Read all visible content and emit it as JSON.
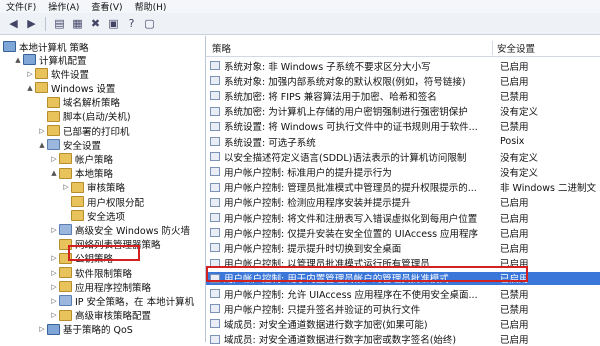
{
  "menu": [
    "文件(F)",
    "操作(A)",
    "查看(V)",
    "帮助(H)"
  ],
  "toolbar_icons": [
    "back-arrow-icon",
    "forward-arrow-icon",
    "up-folder-icon",
    "show-tree-icon",
    "delete-icon",
    "properties-icon",
    "help-icon",
    "console-icon"
  ],
  "tree": {
    "root": "本地计算机 策略",
    "items": [
      {
        "label": "计算机配置",
        "depth": 1,
        "icon": "pc",
        "exp": "▲"
      },
      {
        "label": "软件设置",
        "depth": 2,
        "icon": "fold",
        "exp": "▷"
      },
      {
        "label": "Windows 设置",
        "depth": 2,
        "icon": "fold",
        "exp": "▲"
      },
      {
        "label": "域名解析策略",
        "depth": 3,
        "icon": "fold",
        "exp": ""
      },
      {
        "label": "脚本(启动/关机)",
        "depth": 3,
        "icon": "fold",
        "exp": ""
      },
      {
        "label": "已部署的打印机",
        "depth": 3,
        "icon": "fold",
        "exp": "▷"
      },
      {
        "label": "安全设置",
        "depth": 3,
        "icon": "sec",
        "exp": "▲"
      },
      {
        "label": "帐户策略",
        "depth": 4,
        "icon": "fold",
        "exp": "▷"
      },
      {
        "label": "本地策略",
        "depth": 4,
        "icon": "fold",
        "exp": "▲"
      },
      {
        "label": "审核策略",
        "depth": 5,
        "icon": "fold",
        "exp": "▷"
      },
      {
        "label": "用户权限分配",
        "depth": 5,
        "icon": "fold",
        "exp": ""
      },
      {
        "label": "安全选项",
        "depth": 5,
        "icon": "fold",
        "exp": ""
      },
      {
        "label": "高级安全 Windows 防火墙",
        "depth": 4,
        "icon": "sec",
        "exp": "▷"
      },
      {
        "label": "网络列表管理器策略",
        "depth": 4,
        "icon": "fold",
        "exp": ""
      },
      {
        "label": "公钥策略",
        "depth": 4,
        "icon": "fold",
        "exp": "▷"
      },
      {
        "label": "软件限制策略",
        "depth": 4,
        "icon": "fold",
        "exp": "▷"
      },
      {
        "label": "应用程序控制策略",
        "depth": 4,
        "icon": "fold",
        "exp": "▷"
      },
      {
        "label": "IP 安全策略，在 本地计算机",
        "depth": 4,
        "icon": "sec",
        "exp": "▷"
      },
      {
        "label": "高级审核策略配置",
        "depth": 4,
        "icon": "fold",
        "exp": "▷"
      },
      {
        "label": "基于策略的 QoS",
        "depth": 3,
        "icon": "pc",
        "exp": "▷"
      }
    ]
  },
  "pane": {
    "col_policy": "策略",
    "col_setting": "安全设置",
    "rows": [
      {
        "name": "系统对象: 非 Windows 子系统不要求区分大小写",
        "setting": "已启用"
      },
      {
        "name": "系统对象: 加强内部系统对象的默认权限(例如，符号链接)",
        "setting": "已启用"
      },
      {
        "name": "系统加密: 将 FIPS 兼容算法用于加密、哈希和签名",
        "setting": "已禁用"
      },
      {
        "name": "系统加密: 为计算机上存储的用户密钥强制进行强密钥保护",
        "setting": "没有定义"
      },
      {
        "name": "系统设置: 将 Windows 可执行文件中的证书规则用于软件...",
        "setting": "已禁用"
      },
      {
        "name": "系统设置: 可选子系统",
        "setting": "Posix"
      },
      {
        "name": "以安全描述符定义语言(SDDL)语法表示的计算机访问限制",
        "setting": "没有定义"
      },
      {
        "name": "用户帐户控制: 标准用户的提升提示行为",
        "setting": "没有定义"
      },
      {
        "name": "用户帐户控制: 管理员批准模式中管理员的提升权限提示的...",
        "setting": "非 Windows 二进制文"
      },
      {
        "name": "用户帐户控制: 检测应用程序安装并提示提升",
        "setting": "已启用"
      },
      {
        "name": "用户帐户控制: 将文件和注册表写入错误虚拟化到每用户位置",
        "setting": "已启用"
      },
      {
        "name": "用户帐户控制: 仅提升安装在安全位置的 UIAccess 应用程序",
        "setting": "已启用"
      },
      {
        "name": "用户帐户控制: 提示提升时切换到安全桌面",
        "setting": "已启用"
      },
      {
        "name": "用户帐户控制: 以管理员批准模式运行所有管理员",
        "setting": "已启用"
      },
      {
        "name": "用户帐户控制: 用于内置管理员帐户的管理员批准模式",
        "setting": "已启用"
      },
      {
        "name": "用户帐户控制: 允许 UIAccess 应用程序在不使用安全桌面...",
        "setting": "已禁用"
      },
      {
        "name": "用户帐户控制: 只提升签名并验证的可执行文件",
        "setting": "已禁用"
      },
      {
        "name": "域成员: 对安全通道数据进行数字加密(如果可能)",
        "setting": "已启用"
      },
      {
        "name": "域成员: 对安全通道数据进行数字加密或数字签名(始终)",
        "setting": "已启用"
      }
    ]
  }
}
